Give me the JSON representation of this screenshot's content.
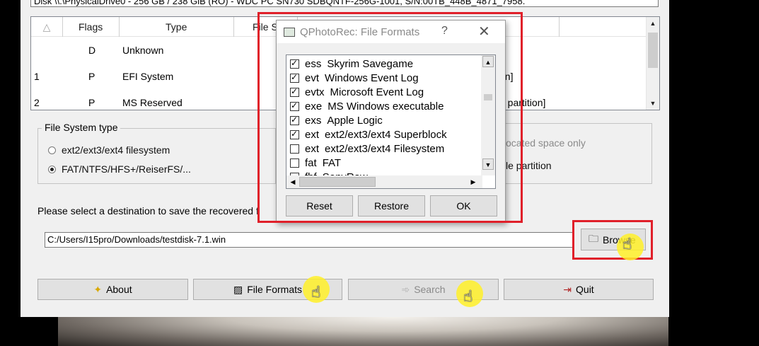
{
  "disk_selector": "Disk \\\\.\\PhysicalDrive0 - 256 GB / 238 GiB (RO) - WDC PC SN730 SDBQNTF-256G-1001, S/N:00TB_448B_4871_7958.",
  "partition_table": {
    "headers": [
      "Flags",
      "Type",
      "File S"
    ],
    "rows": [
      {
        "num": "",
        "flag": "D",
        "type": "Unknown",
        "tail": ""
      },
      {
        "num": "1",
        "flag": "P",
        "type": "EFI System",
        "tail": "on]"
      },
      {
        "num": "2",
        "flag": "P",
        "type": "MS Reserved",
        "tail": "d partition]"
      }
    ]
  },
  "fs_group": {
    "title": "File System type",
    "options": [
      "ext2/ext3/ext4 filesystem",
      "FAT/NTFS/HFS+/ReiserFS/..."
    ],
    "selected_index": 1
  },
  "scope_group": {
    "opt1_tail": "ocated space only",
    "opt2_tail": "le partition"
  },
  "destination": {
    "label": "Please select a destination to save the recovered f",
    "path": "C:/Users/I15pro/Downloads/testdisk-7.1.win",
    "browse_label": "Browse"
  },
  "buttons": {
    "about": "About",
    "file_formats": "File Formats",
    "search": "Search",
    "quit": "Quit"
  },
  "dialog": {
    "title": "QPhotoRec: File Formats",
    "help": "?",
    "close": "✕",
    "formats": [
      {
        "ext": "ess",
        "desc": "Skyrim Savegame",
        "checked": true
      },
      {
        "ext": "evt",
        "desc": "Windows Event Log",
        "checked": true
      },
      {
        "ext": "evtx",
        "desc": "Microsoft Event Log",
        "checked": true
      },
      {
        "ext": "exe",
        "desc": "MS Windows executable",
        "checked": true
      },
      {
        "ext": "exs",
        "desc": "Apple Logic",
        "checked": true
      },
      {
        "ext": "ext",
        "desc": "ext2/ext3/ext4 Superblock",
        "checked": true
      },
      {
        "ext": "ext",
        "desc": "ext2/ext3/ext4 Filesystem",
        "checked": false
      },
      {
        "ext": "fat",
        "desc": "FAT",
        "checked": false
      },
      {
        "ext": "fbf",
        "desc": "SonyRaw",
        "checked": false
      }
    ],
    "reset": "Reset",
    "restore": "Restore",
    "ok": "OK"
  },
  "colors": {
    "annotation_red": "#e0202a",
    "cursor_highlight": "#fff028"
  }
}
